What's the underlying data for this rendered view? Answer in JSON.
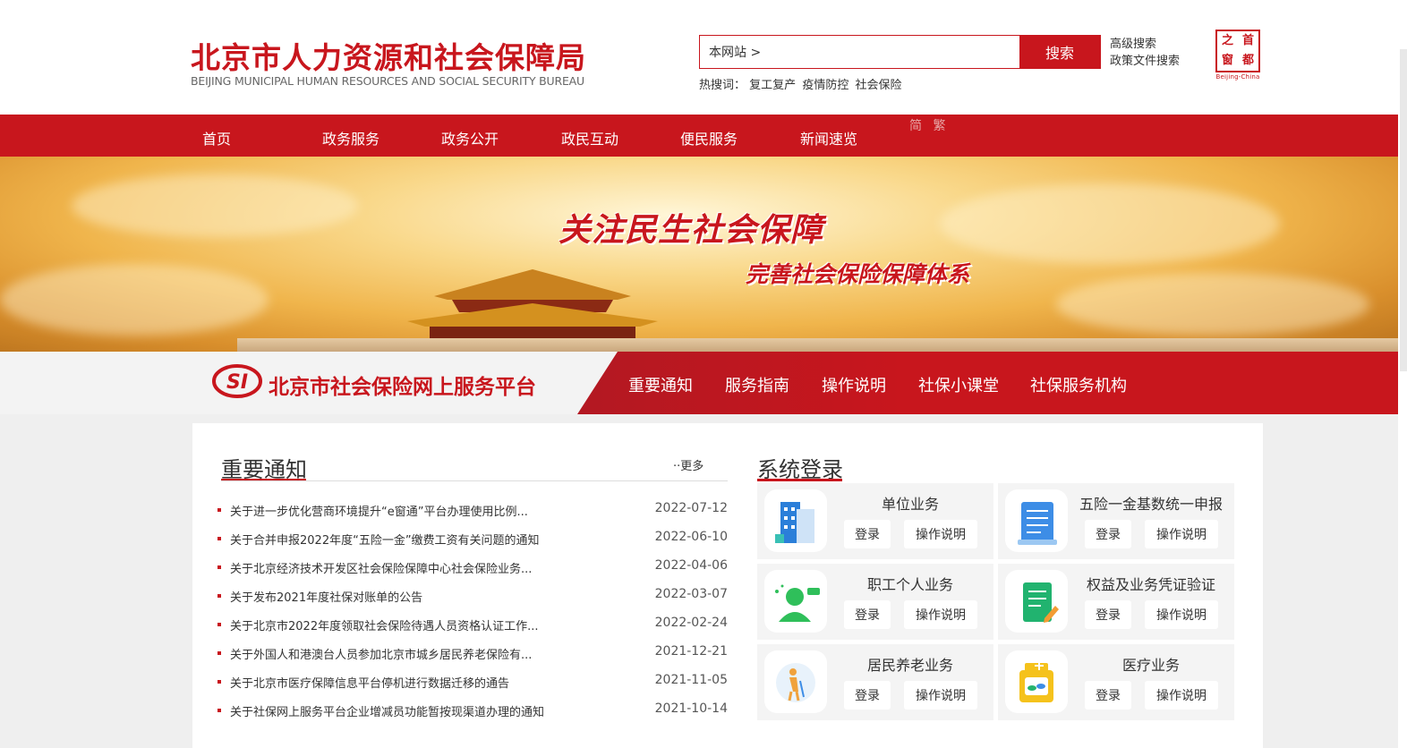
{
  "header": {
    "title": "北京市人力资源和社会保障局",
    "subtitle": "BEIJING MUNICIPAL HUMAN RESOURCES AND SOCIAL SECURITY BUREAU",
    "search_scope": "本网站 >",
    "search_button": "搜索",
    "advanced_search": "高级搜索",
    "policy_search": "政策文件搜索",
    "hot_label": "热搜词：",
    "hot_keywords": [
      "复工复产",
      "疫情防控",
      "社会保险"
    ],
    "seal_chars": [
      "之",
      "首",
      "窗",
      "都"
    ],
    "seal_caption": "Beijing-China"
  },
  "nav": {
    "items": [
      "首页",
      "政务服务",
      "政务公开",
      "政民互动",
      "便民服务",
      "新闻速览"
    ],
    "lang": "简 繁"
  },
  "banner": {
    "title": "关注民生社会保障",
    "subtitle": "完善社会保险保障体系"
  },
  "platform": {
    "logo_text": "SI",
    "title": "北京市社会保险网上服务平台",
    "tabs": [
      "重要通知",
      "服务指南",
      "操作说明",
      "社保小课堂",
      "社保服务机构"
    ]
  },
  "notices": {
    "title": "重要通知",
    "more": "··更多",
    "items": [
      {
        "title": "关于进一步优化营商环境提升“e窗通”平台办理使用比例...",
        "date": "2022-07-12"
      },
      {
        "title": "关于合并申报2022年度“五险一金”缴费工资有关问题的通知",
        "date": "2022-06-10"
      },
      {
        "title": "关于北京经济技术开发区社会保险保障中心社会保险业务...",
        "date": "2022-04-06"
      },
      {
        "title": "关于发布2021年度社保对账单的公告",
        "date": "2022-03-07"
      },
      {
        "title": "关于北京市2022年度领取社会保险待遇人员资格认证工作...",
        "date": "2022-02-24"
      },
      {
        "title": "关于外国人和港澳台人员参加北京市城乡居民养老保险有...",
        "date": "2021-12-21"
      },
      {
        "title": "关于北京市医疗保障信息平台停机进行数据迁移的通告",
        "date": "2021-11-05"
      },
      {
        "title": "关于社保网上服务平台企业增减员功能暂按现渠道办理的通知",
        "date": "2021-10-14"
      }
    ]
  },
  "login": {
    "title": "系统登录",
    "login_label": "登录",
    "help_label": "操作说明",
    "cards": [
      {
        "name": "单位业务",
        "icon": "building-icon"
      },
      {
        "name": "五险一金基数统一申报",
        "icon": "document-icon"
      },
      {
        "name": "职工个人业务",
        "icon": "person-icon"
      },
      {
        "name": "权益及业务凭证验证",
        "icon": "certificate-icon"
      },
      {
        "name": "居民养老业务",
        "icon": "elderly-icon"
      },
      {
        "name": "医疗业务",
        "icon": "medical-icon"
      }
    ]
  },
  "colors": {
    "brand_red": "#c8161d"
  }
}
